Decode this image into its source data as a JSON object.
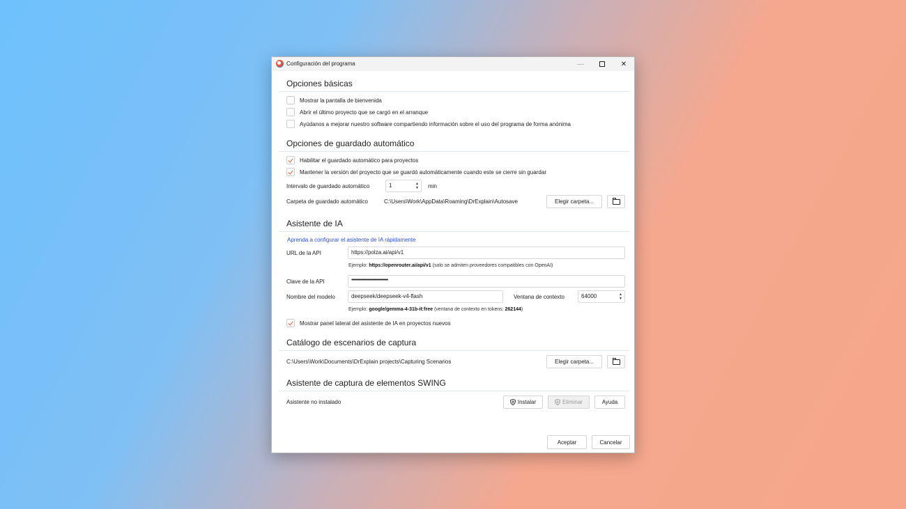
{
  "window": {
    "title": "Configuración del programa"
  },
  "basic": {
    "title": "Opciones básicas",
    "options": [
      {
        "label": "Mostrar la pantalla de bienvenida",
        "checked": false
      },
      {
        "label": "Abrir el último proyecto que se cargó en el arranque",
        "checked": false
      },
      {
        "label": "Ayúdanos a mejorar nuestro software compartiendo información sobre el uso  del programa de forma anónima",
        "checked": false
      }
    ]
  },
  "autosave": {
    "title": "Opciones de guardado automático",
    "options": [
      {
        "label": "Habilitar el guardado automático para proyectos",
        "checked": true
      },
      {
        "label": "Mantener la versión del proyecto que se guardó automáticamente cuando este se cierre sin guardar",
        "checked": true
      }
    ],
    "interval_label": "Intervalo de guardado automático",
    "interval_value": "1",
    "interval_unit": "min",
    "folder_label": "Carpeta de guardado automático",
    "folder_path": "C:\\Users\\Work\\AppData\\Roaming\\DrExplain\\Autosave",
    "choose_folder": "Elegir carpeta..."
  },
  "ai": {
    "title": "Asistente de IA",
    "link": "Aprenda a configurar el asistente de IA rápidamente",
    "api_url_label": "URL de la API",
    "api_url_value": "https://polza.ai/api/v1",
    "api_url_hint_prefix": "Ejemplo:",
    "api_url_hint_bold": "https://openrouter.ai/api/v1",
    "api_url_hint_suffix": "(solo se admiten proveedores compatibles con OpenAI)",
    "api_key_label": "Clave de la API",
    "api_key_value": "••••••••••••••••••••••••••••••••••••",
    "model_label": "Nombre del modelo",
    "model_value": "deepseek/deepseek-v4-flash",
    "context_label": "Ventana de contexto",
    "context_value": "64000",
    "model_hint_prefix": "Ejemplo:",
    "model_hint_bold": "google/gemma-4-31b-it:free",
    "model_hint_mid": "(ventana de contexto en tokens:",
    "model_hint_tokens": "262144",
    "model_hint_end": ")",
    "panel_option": {
      "label": "Mostrar panel lateral del asistente de IA en proyectos nuevos",
      "checked": true
    }
  },
  "catalog": {
    "title": "Catálogo de escenarios de captura",
    "path": "C:\\Users\\Work\\Documents\\DrExplain projects\\Capturing Scenarios",
    "choose_folder": "Elegir carpeta..."
  },
  "swing": {
    "title": "Asistente de captura de elementos SWING",
    "status": "Asistente no instalado",
    "install": "Instalar",
    "remove": "Eliminar",
    "help": "Ayuda"
  },
  "footer": {
    "accept": "Aceptar",
    "cancel": "Cancelar"
  },
  "colors": {
    "accent": "#e05a3a",
    "link": "#2b4fd8"
  },
  "icons": [
    "app-icon",
    "minimize-icon",
    "maximize-icon",
    "close-icon",
    "folder-open-icon",
    "shield-icon",
    "spin-arrows-icon"
  ]
}
